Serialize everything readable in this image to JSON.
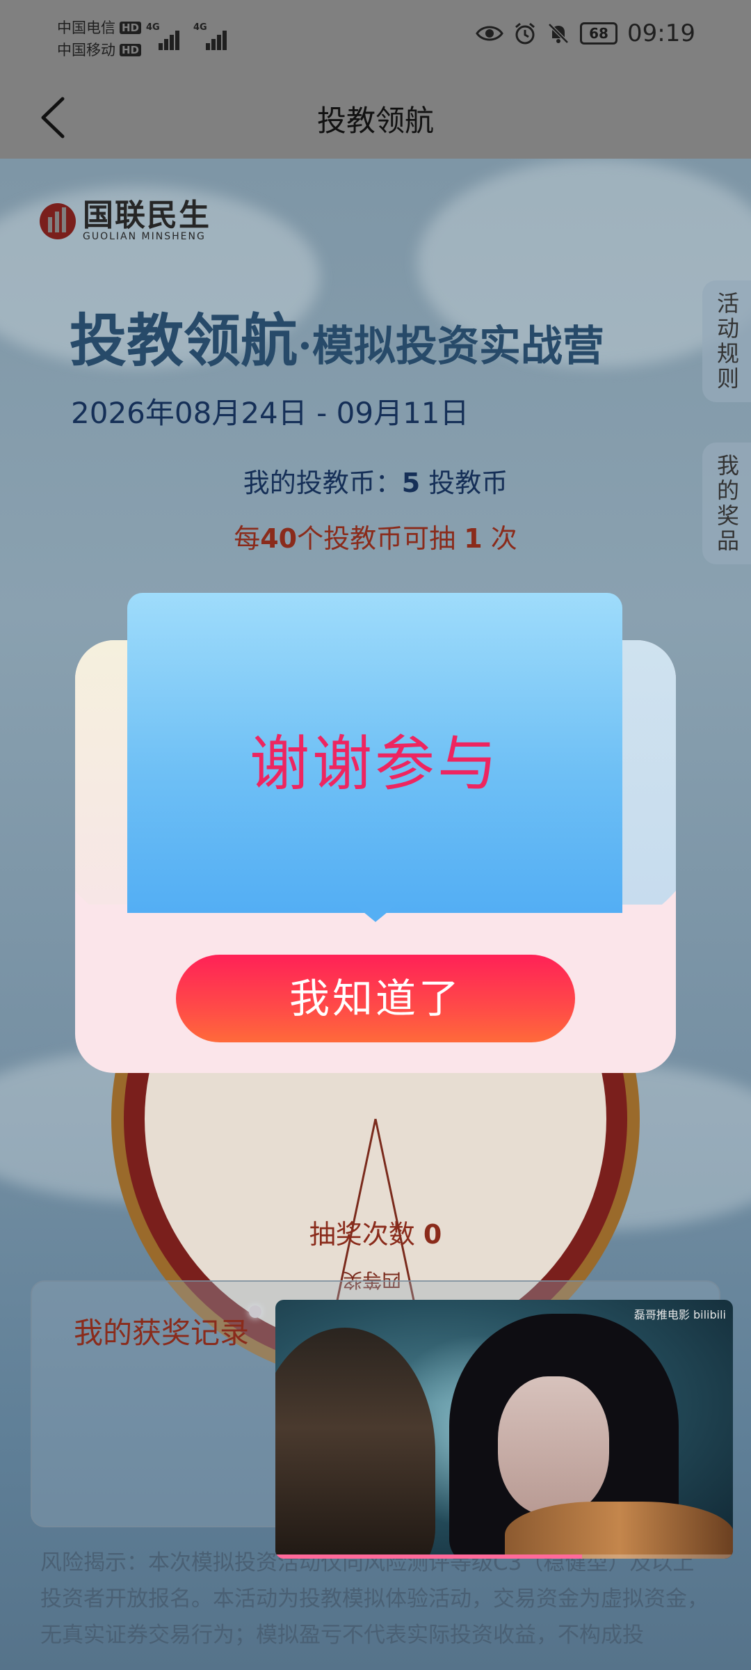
{
  "status_bar": {
    "carrier1": "中国电信",
    "carrier2": "中国移动",
    "hd": "HD",
    "network": "4G",
    "battery": "68",
    "time": "09:19"
  },
  "header": {
    "title": "投教领航",
    "back_icon": "chevron-left-icon"
  },
  "brand": {
    "name_cn": "国联民生",
    "name_en": "GUOLIAN MINSHENG"
  },
  "campaign": {
    "title_main": "投教领航",
    "title_dot": "·",
    "title_sub": "模拟投资实战营",
    "date_range": "2026年08月24日 - 09月11日",
    "coins_label": "我的投教币：",
    "coins_value": "5",
    "coins_unit": " 投教币",
    "rule_prefix": "每",
    "rule_coins": "40",
    "rule_middle": "个投教币可抽 ",
    "rule_times": "1",
    "rule_suffix": " 次"
  },
  "side_tabs": {
    "rules": "活动规则",
    "prizes": "我的奖品"
  },
  "wheel": {
    "visible_label": "四等奖"
  },
  "draws": {
    "label": "抽奖次数 ",
    "value": "0"
  },
  "records": {
    "title": "我的获奖记录"
  },
  "risk_notice": "风险揭示：本次模拟投资活动仅向风险测评等级C3（稳健型）及以上投资者开放报名。本活动为投教模拟体验活动，交易资金为虚拟资金，无真实证券交易行为；模拟盈亏不代表实际投资收益，不构成投",
  "modal": {
    "result": "谢谢参与",
    "button": "我知道了"
  },
  "video": {
    "watermark": "磊哥推电影 bilibili",
    "progress": 0.67
  },
  "colors": {
    "accent_red": "#ee2560",
    "button_gradient_start": "#ff2157",
    "button_gradient_end": "#ff6a3a",
    "card_blue": "#6fc0f5",
    "dark_red_text": "#8a2b1b",
    "navy_text": "#152f57"
  }
}
